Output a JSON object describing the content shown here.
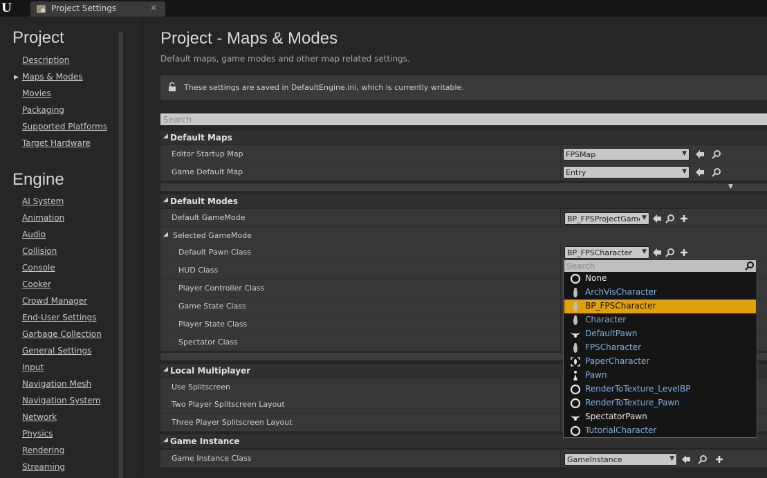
{
  "tab": {
    "title": "Project Settings",
    "close": "×"
  },
  "sidebar": {
    "project_heading": "Project",
    "project_items": [
      "Description",
      "Maps & Modes",
      "Movies",
      "Packaging",
      "Supported Platforms",
      "Target Hardware"
    ],
    "engine_heading": "Engine",
    "engine_items": [
      "AI System",
      "Animation",
      "Audio",
      "Collision",
      "Console",
      "Cooker",
      "Crowd Manager",
      "End-User Settings",
      "Garbage Collection",
      "General Settings",
      "Input",
      "Navigation Mesh",
      "Navigation System",
      "Network",
      "Physics",
      "Rendering",
      "Streaming"
    ]
  },
  "main": {
    "title": "Project - Maps & Modes",
    "description": "Default maps, game modes and other map related settings.",
    "notice": "These settings are saved in DefaultEngine.ini, which is currently writable.",
    "search_placeholder": "Search"
  },
  "sections": {
    "default_maps": {
      "label": "Default Maps",
      "editor_startup_map": {
        "label": "Editor Startup Map",
        "value": "FPSMap"
      },
      "game_default_map": {
        "label": "Game Default Map",
        "value": "Entry"
      }
    },
    "default_modes": {
      "label": "Default Modes",
      "default_gamemode": {
        "label": "Default GameMode",
        "value": "BP_FPSProjectGame"
      },
      "selected_gamemode": "Selected GameMode",
      "default_pawn_class": {
        "label": "Default Pawn Class",
        "value": "BP_FPSCharacter"
      },
      "hud_class": "HUD Class",
      "player_controller_class": "Player Controller Class",
      "game_state_class": "Game State Class",
      "player_state_class": "Player State Class",
      "spectator_class": "Spectator Class"
    },
    "local_multiplayer": {
      "label": "Local Multiplayer",
      "use_splitscreen": "Use Splitscreen",
      "two_player_layout": "Two Player Splitscreen Layout",
      "three_player_layout": "Three Player Splitscreen Layout"
    },
    "game_instance": {
      "label": "Game Instance",
      "game_instance_class": {
        "label": "Game Instance Class",
        "value": "GameInstance"
      }
    }
  },
  "dropdown": {
    "search_placeholder": "Search",
    "selected": "BP_FPSCharacter",
    "items": [
      {
        "label": "None",
        "icon": "circle-icon",
        "color": "#e6e6e6"
      },
      {
        "label": "ArchVisCharacter",
        "icon": "character-icon",
        "color": "#7fb0e0"
      },
      {
        "label": "BP_FPSCharacter",
        "icon": "character-icon",
        "color": "#111111"
      },
      {
        "label": "Character",
        "icon": "character-icon",
        "color": "#7fb0e0"
      },
      {
        "label": "DefaultPawn",
        "icon": "pawn-wings-icon",
        "color": "#7fb0e0"
      },
      {
        "label": "FPSCharacter",
        "icon": "character-icon",
        "color": "#7fb0e0"
      },
      {
        "label": "PaperCharacter",
        "icon": "paper-character-icon",
        "color": "#7fb0e0"
      },
      {
        "label": "Pawn",
        "icon": "pawn-icon",
        "color": "#7fb0e0"
      },
      {
        "label": "RenderToTexture_LevelBP",
        "icon": "circle-icon",
        "color": "#7fb0e0"
      },
      {
        "label": "RenderToTexture_Pawn",
        "icon": "circle-icon",
        "color": "#7fb0e0"
      },
      {
        "label": "SpectatorPawn",
        "icon": "pawn-wings-icon",
        "color": "#e6e6e6"
      },
      {
        "label": "TutorialCharacter",
        "icon": "circle-icon",
        "color": "#7fb0e0"
      }
    ]
  },
  "colors": {
    "selection": "#e0a10a",
    "link_blue": "#7fb0e0",
    "background": "#262626"
  }
}
